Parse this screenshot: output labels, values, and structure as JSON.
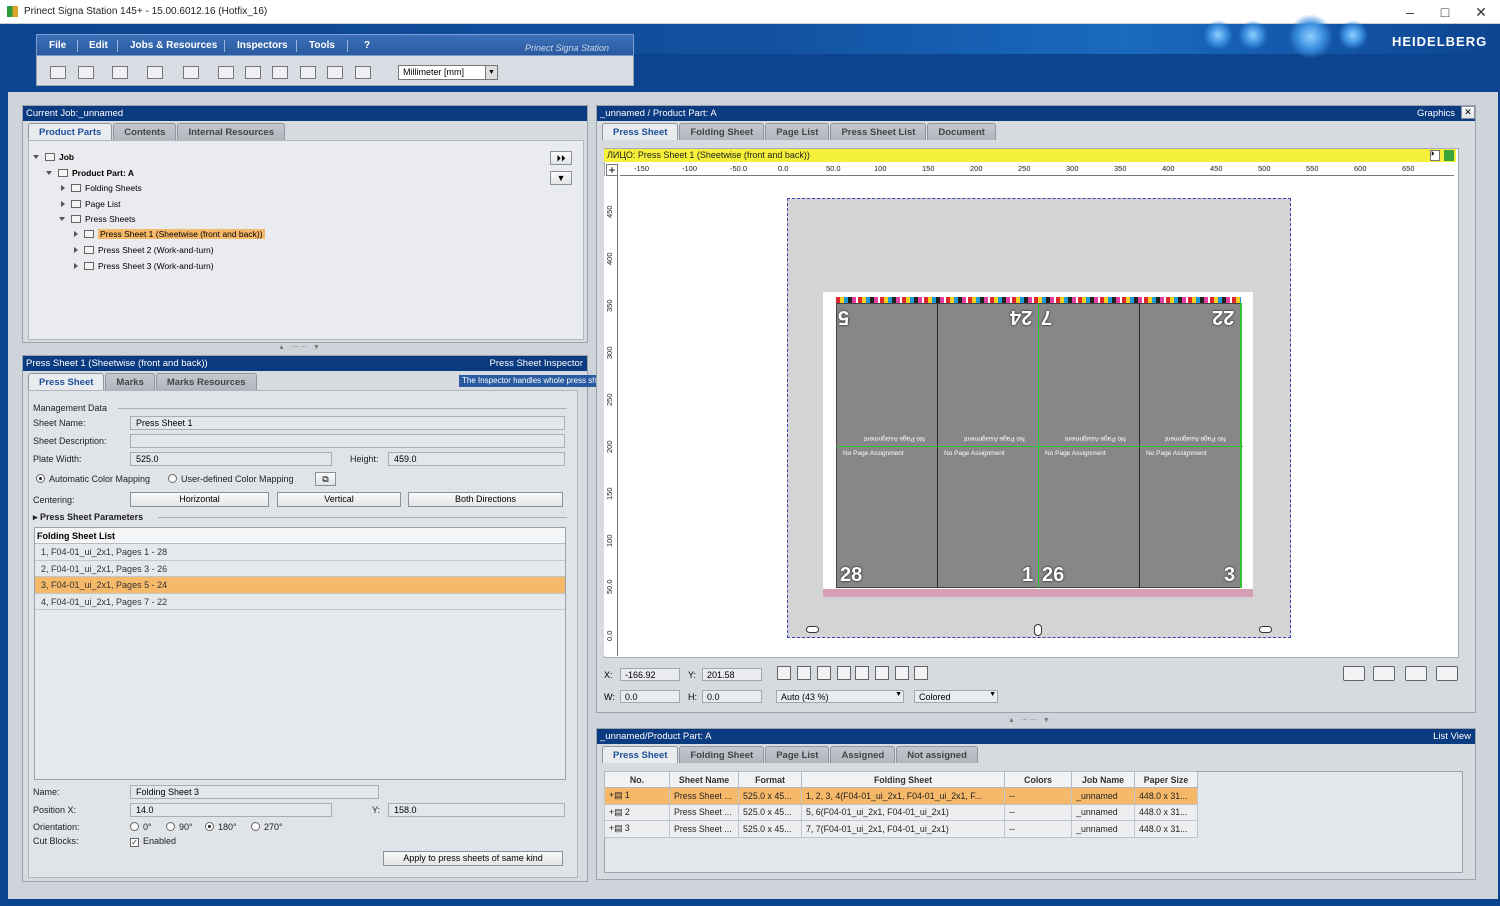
{
  "window": {
    "title": "Prinect Signa Station 145+  -  15.00.6012.16 (Hotfix_16)",
    "brand": "Prinect Signa Station",
    "logo": "HEIDELBERG"
  },
  "menu": [
    "File",
    "Edit",
    "Jobs & Resources",
    "Inspectors",
    "Tools",
    "?"
  ],
  "toolbar": {
    "unit": "Millimeter  [mm]"
  },
  "job_panel": {
    "title": "Current Job:_unnamed",
    "tabs": [
      "Product Parts",
      "Contents",
      "Internal Resources"
    ],
    "tree": [
      "Job",
      "Product Part: A",
      "Folding Sheets",
      "Page List",
      "Press Sheets",
      "Press Sheet 1 (Sheetwise (front and back))",
      "Press Sheet 2 (Work-and-turn)",
      "Press Sheet 3 (Work-and-turn)"
    ]
  },
  "inspector": {
    "title": "Press Sheet 1 (Sheetwise (front and back))",
    "right": "Press Sheet Inspector",
    "tooltip": "The Inspector handles whole press sheets (maximize with double click)",
    "tabs": [
      "Press Sheet",
      "Marks",
      "Marks Resources"
    ],
    "section": "Management Data",
    "labels": {
      "sheet_name": "Sheet Name:",
      "sheet_desc": "Sheet Description:",
      "plate_width": "Plate Width:",
      "height": "Height:",
      "centering": "Centering:",
      "params": "Press Sheet Parameters",
      "name": "Name:",
      "posx": "Position X:",
      "y": "Y:",
      "orientation": "Orientation:",
      "cut": "Cut Blocks:"
    },
    "values": {
      "sheet_name": "Press Sheet 1",
      "sheet_desc": "",
      "plate_width": "525.0",
      "height": "459.0",
      "name": "Folding Sheet 3",
      "posx": "14.0",
      "y": "158.0"
    },
    "color_mapping": [
      "Automatic Color Mapping",
      "User-defined Color Mapping"
    ],
    "centering_buttons": [
      "Horizontal",
      "Vertical",
      "Both Directions"
    ],
    "folding_list": {
      "header": "Folding Sheet List",
      "rows": [
        "1, F04-01_ui_2x1, Pages 1 - 28",
        "2, F04-01_ui_2x1, Pages 3 - 26",
        "3, F04-01_ui_2x1, Pages 5 - 24",
        "4, F04-01_ui_2x1, Pages 7 - 22"
      ]
    },
    "orientation": [
      "0°",
      "90°",
      "180°",
      "270°"
    ],
    "cut_enabled": "Enabled",
    "apply": "Apply to press sheets of same kind"
  },
  "graphics": {
    "title": "_unnamed / Product Part: A",
    "right": "Graphics",
    "close": "✕",
    "tabs": [
      "Press Sheet",
      "Folding Sheet",
      "Page List",
      "Press Sheet List",
      "Document"
    ],
    "yellow": "ЛИЦО:  Press Sheet 1 (Sheetwise (front and back))",
    "hticks": [
      "-150",
      "-100",
      "-50.0",
      "0.0",
      "50.0",
      "100",
      "150",
      "200",
      "250",
      "300",
      "350",
      "400",
      "450",
      "500",
      "550",
      "600",
      "650"
    ],
    "vticks": [
      "450",
      "400",
      "350",
      "300",
      "250",
      "200",
      "150",
      "100",
      "50.0",
      "0.0"
    ],
    "pages_top": [
      "5",
      "24",
      "7",
      "22"
    ],
    "pages_bottom": [
      "28",
      "1",
      "26",
      "3"
    ],
    "npa": "No Page Assignment",
    "x_lab": "X:",
    "x": "-166.92",
    "y_lab": "Y:",
    "y": "201.58",
    "w_lab": "W:",
    "w": "0.0",
    "h_lab": "H:",
    "h": "0.0",
    "zoom": "Auto (43 %)",
    "mode": "Colored"
  },
  "list_view": {
    "title": "_unnamed/Product Part: A",
    "right": "List View",
    "tabs": [
      "Press Sheet",
      "Folding Sheet",
      "Page List",
      "Assigned",
      "Not assigned"
    ],
    "columns": [
      "No.",
      "Sheet Name",
      "Format",
      "Folding Sheet",
      "Colors",
      "Job Name",
      "Paper Size"
    ],
    "rows": [
      [
        "1",
        "Press Sheet ...",
        "525.0 x 45...",
        "1, 2, 3, 4(F04-01_ui_2x1, F04-01_ui_2x1, F...",
        "--",
        "_unnamed",
        "448.0 x 31..."
      ],
      [
        "2",
        "Press Sheet ...",
        "525.0 x 45...",
        "5, 6(F04-01_ui_2x1, F04-01_ui_2x1)",
        "--",
        "_unnamed",
        "448.0 x 31..."
      ],
      [
        "3",
        "Press Sheet ...",
        "525.0 x 45...",
        "7, 7(F04-01_ui_2x1, F04-01_ui_2x1)",
        "--",
        "_unnamed",
        "448.0 x 31..."
      ]
    ]
  }
}
